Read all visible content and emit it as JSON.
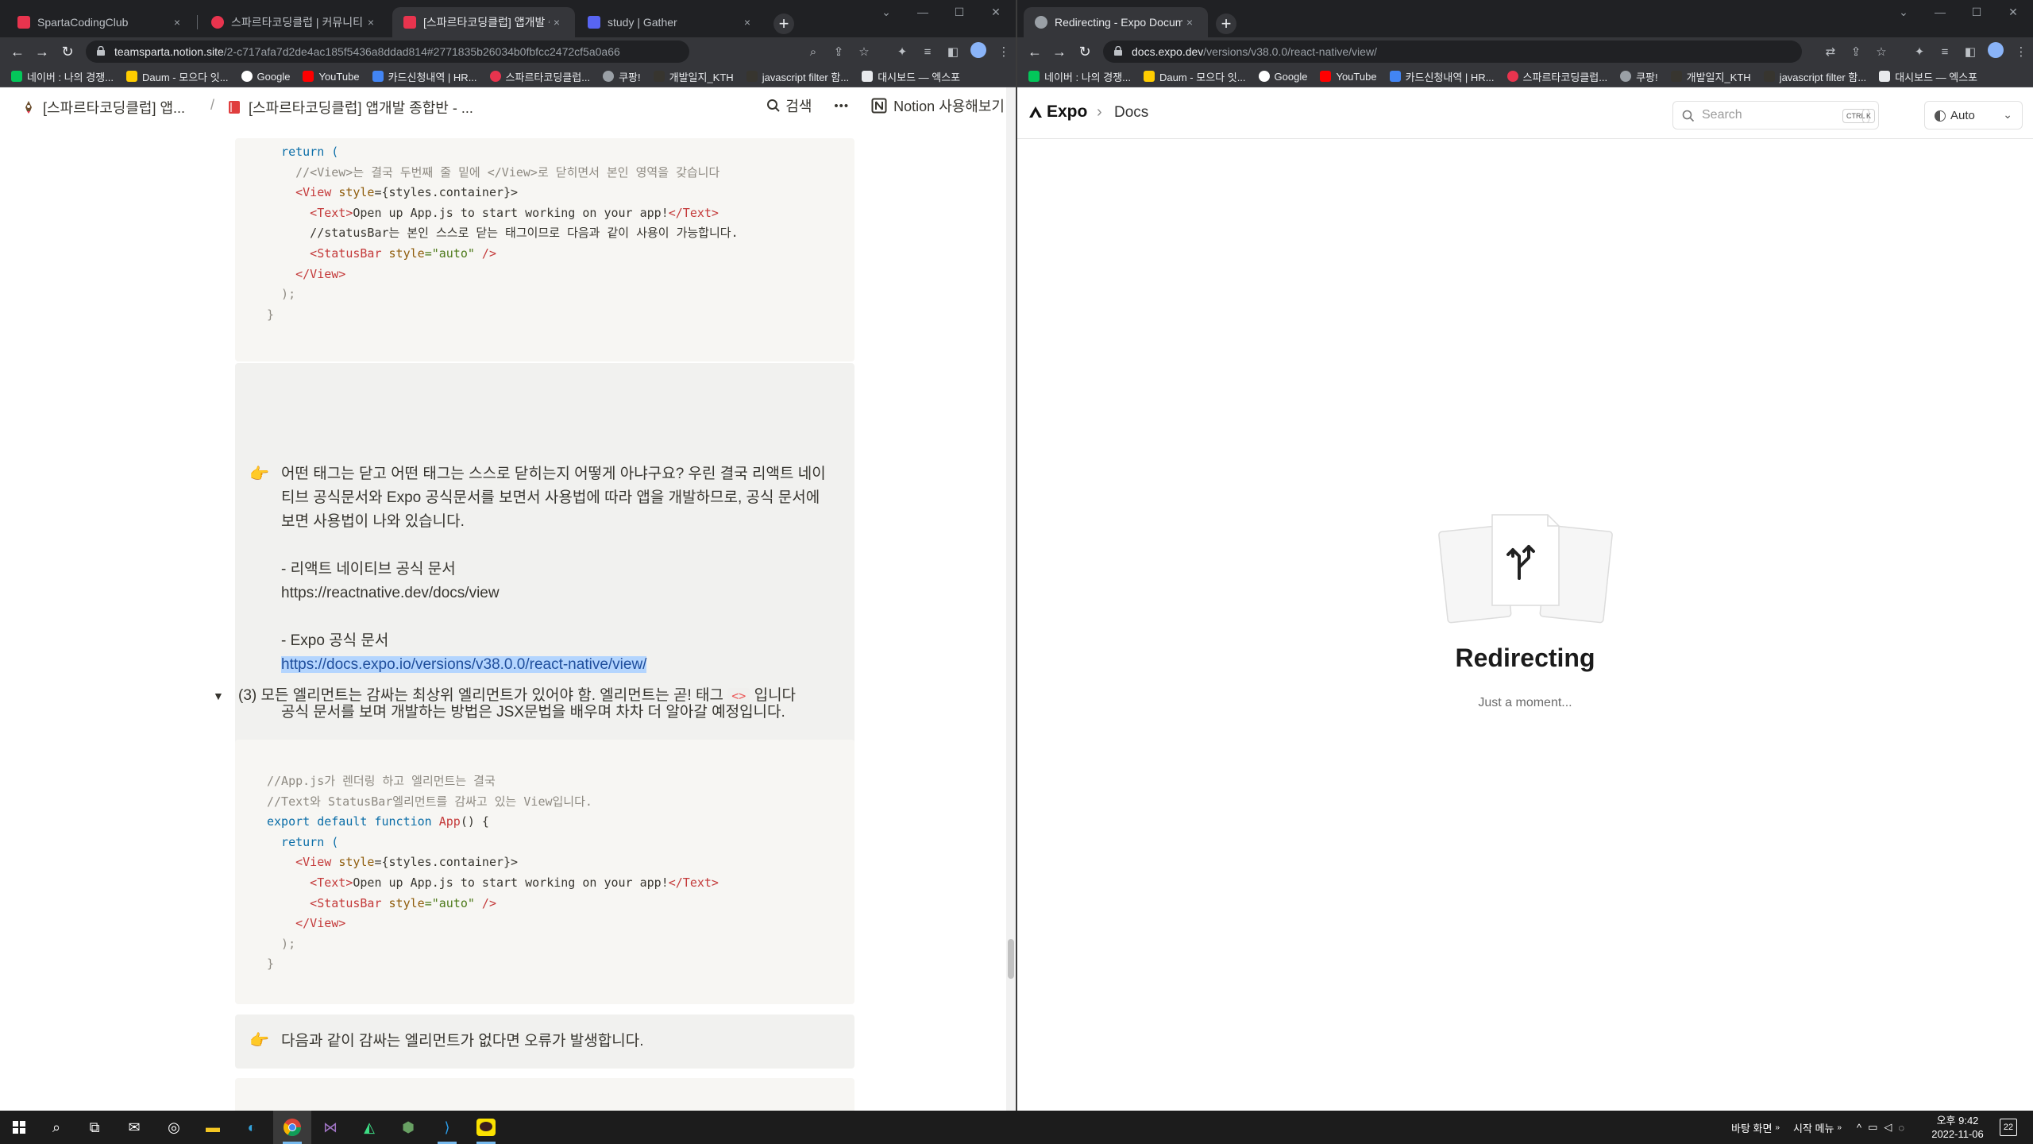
{
  "left_browser": {
    "tabs": [
      {
        "title": "SpartaCodingClub",
        "close": "×"
      },
      {
        "title": "스파르타코딩클럽 | 커뮤니티",
        "close": "×"
      },
      {
        "title": "[스파르타코딩클럽] 앱개발 종합",
        "close": "×"
      },
      {
        "title": "study | Gather",
        "close": "×"
      }
    ],
    "new_tab": "+",
    "window_controls": [
      "⌄",
      "—",
      "☐",
      "✕"
    ],
    "url_host": "teamsparta.notion.site",
    "url_path": "/2-c717afa7d2de4ac185f5436a8ddad814#2771835b26034b0fbfcc2472cf5a0a66",
    "bookmarks": [
      "네이버 : 나의 경쟁...",
      "Daum - 모으다 잇...",
      "Google",
      "YouTube",
      "카드신청내역 | HR...",
      "스파르타코딩클럽...",
      "쿠팡!",
      "개발일지_KTH",
      "javascript filter 함...",
      "대시보드 — 엑스포"
    ]
  },
  "notion": {
    "breadcrumb_1": "[스파르타코딩클럽] 앱...",
    "breadcrumb_sep": "/",
    "breadcrumb_2": "[스파르타코딩클럽] 앱개발 종합반 - ...",
    "search_label": "검색",
    "more_label": "•••",
    "try_notion": "Notion 사용해보기",
    "code1": {
      "l1": "  return (",
      "l2": "    //<View>는 결국 두번째 줄 밑에 </View>로 닫히면서 본인 영역을 갖습니다",
      "l3_tag": "    <View ",
      "l3_attr": "style",
      "l3_val": "={styles.container}>",
      "l4_open": "      <Text>",
      "l4_text": "Open up App.js to start working on your app!",
      "l4_close": "</Text>",
      "l5": "      //statusBar는 본인 스스로 닫는 태그이므로 다음과 같이 사용이 가능합니다.",
      "l6_tag": "      <StatusBar ",
      "l6_attr": "style",
      "l6_val": "=\"auto\"",
      "l6_end": " />",
      "l7": "    </View>",
      "l8": "  );",
      "l9": "}"
    },
    "callout1": {
      "emoji": "👉",
      "p1": "어떤 태그는 닫고 어떤 태그는 스스로 닫히는지 어떻게 아냐구요? 우린 결국 리액트 네이티브 공식문서와 Expo 공식문서를 보면서 사용법에 따라 앱을 개발하므로, 공식 문서에 보면 사용법이 나와 있습니다.",
      "p2": "- 리액트 네이티브 공식 문서",
      "p3": "https://reactnative.dev/docs/view",
      "p4": "- Expo 공식 문서",
      "p5": "https://docs.expo.io/versions/v38.0.0/react-native/view/",
      "p6": "공식 문서를 보며 개발하는 방법은 JSX문법을 배우며 차차 더 알아갈 예정입니다."
    },
    "toggle": {
      "arrow": "▼",
      "text_before": "(3) 모든 엘리먼트는 감싸는 최상위 엘리먼트가 있어야 함. 엘리먼트는 곧! 태그 ",
      "code": "<>",
      "text_after": " 입니다"
    },
    "code2": {
      "l1": "//App.js가 렌더링 하고 엘리먼트는 결국",
      "l2": "//Text와 StatusBar엘리먼트를 감싸고 있는 View입니다.",
      "l3_kw": "export default function ",
      "l3_fn": "App",
      "l3_end": "() {",
      "l4": "  return (",
      "l5_tag": "    <View ",
      "l5_attr": "style",
      "l5_val": "={styles.container}>",
      "l6_open": "      <Text>",
      "l6_text": "Open up App.js to start working on your app!",
      "l6_close": "</Text>",
      "l7_tag": "      <StatusBar ",
      "l7_attr": "style",
      "l7_val": "=\"auto\"",
      "l7_end": " />",
      "l8": "    </View>",
      "l9": "  );",
      "l10": "}"
    },
    "callout2": {
      "emoji": "👉",
      "text": "다음과 같이 감싸는 엘리먼트가 없다면 오류가 발생합니다."
    }
  },
  "right_browser": {
    "tab_title": "Redirecting - Expo Documentati",
    "close": "×",
    "new_tab": "+",
    "window_controls": [
      "⌄",
      "—",
      "☐",
      "✕"
    ],
    "url_host": "docs.expo.dev",
    "url_path": "/versions/v38.0.0/react-native/view/",
    "bookmarks": [
      "네이버 : 나의 경쟁...",
      "Daum - 모으다 잇...",
      "Google",
      "YouTube",
      "카드신청내역 | HR...",
      "스파르타코딩클럽...",
      "쿠팡!",
      "개발일지_KTH",
      "javascript filter 함...",
      "대시보드 — 엑스포"
    ]
  },
  "expo": {
    "logo": "Expo",
    "chevron": "›",
    "section": "Docs",
    "search_placeholder": "Search",
    "kbd_ctrl": "CTRL",
    "kbd_k": "K",
    "theme": "Auto",
    "theme_caret": "⌄",
    "title": "Redirecting",
    "subtitle": "Just a moment..."
  },
  "taskbar": {
    "tray_desktop": "바탕 화면",
    "tray_start": "시작 메뉴",
    "time": "오후 9:42",
    "date": "2022-11-06",
    "notifications": "22"
  },
  "colors": {
    "chrome_dark": "#202124",
    "chrome_toolbar": "#35363a",
    "notion_code_bg": "#f7f6f3",
    "notion_callout_bg": "#f1f1ef",
    "selection": "#b4d5fe"
  }
}
